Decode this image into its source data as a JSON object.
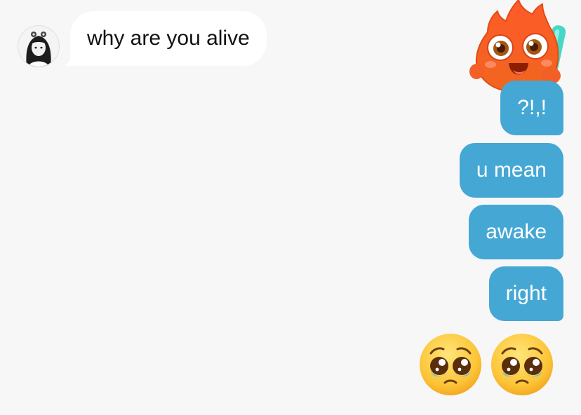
{
  "conversation": {
    "incoming": {
      "text": "why are you alive"
    },
    "outgoing": [
      {
        "text": "?!,!"
      },
      {
        "text": "u mean"
      },
      {
        "text": "awake"
      },
      {
        "text": "right"
      }
    ],
    "sticker": {
      "icon": "fire-mascot-sticker"
    },
    "reactions": [
      {
        "icon": "pleading-face-icon"
      },
      {
        "icon": "pleading-face-icon"
      }
    ]
  },
  "colors": {
    "background": "#f7f7f7",
    "incoming_bubble": "#ffffff",
    "outgoing_bubble": "#45a7d4",
    "outgoing_text": "#ffffff"
  }
}
